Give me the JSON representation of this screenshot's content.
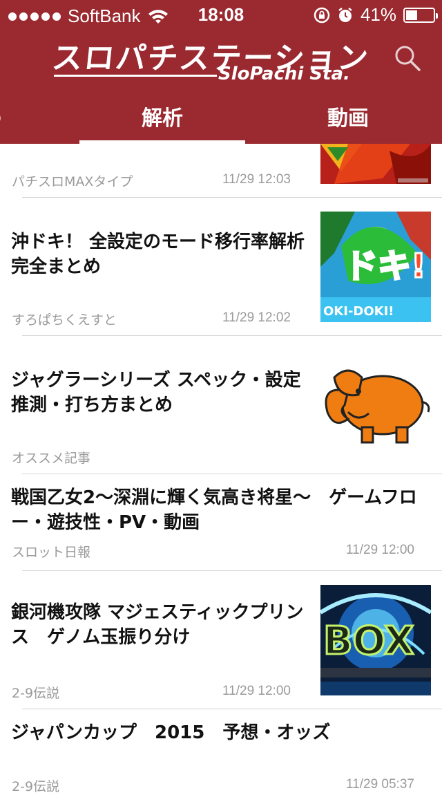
{
  "status_bar": {
    "carrier": "SoftBank",
    "time": "18:08",
    "battery": "41%",
    "battery_level": 0.41
  },
  "header": {
    "logo_text": "スロパチステーション",
    "logo_subtitle": "SloPachi Sta.",
    "background_color": "#9a2930",
    "search_icon": "search-icon"
  },
  "tabs": {
    "previous_partial": "う",
    "active": "解析",
    "next": "動画"
  },
  "articles": [
    {
      "title": "",
      "source": "パチスロMAXタイプ",
      "date": "11/29 12:03",
      "thumbnail": "partial-red-banner"
    },
    {
      "title": "沖ドキ！ 全設定のモード移行率解析 完全まとめ",
      "source": "すろぱちくえすと",
      "date": "11/29 12:02",
      "thumbnail": "okidoki-logo"
    },
    {
      "title": "ジャグラーシリーズ スペック・設定推測・打ち方まとめ",
      "source": "オススメ記事",
      "date": "",
      "thumbnail": "orange-elephant"
    },
    {
      "title": "戦国乙女2〜深淵に輝く気高き将星〜　ゲームフロー・遊技性・PV・動画",
      "source": "スロット日報",
      "date": "11/29 12:00",
      "thumbnail": ""
    },
    {
      "title": "銀河機攻隊 マジェスティックプリンス　ゲノム玉振り分け",
      "source": "2-9伝説",
      "date": "11/29 12:00",
      "thumbnail": "blue-neon-logo"
    },
    {
      "title": "ジャパンカップ　2015　予想・オッズ",
      "source": "2-9伝説",
      "date": "11/29 05:37",
      "thumbnail": ""
    }
  ]
}
